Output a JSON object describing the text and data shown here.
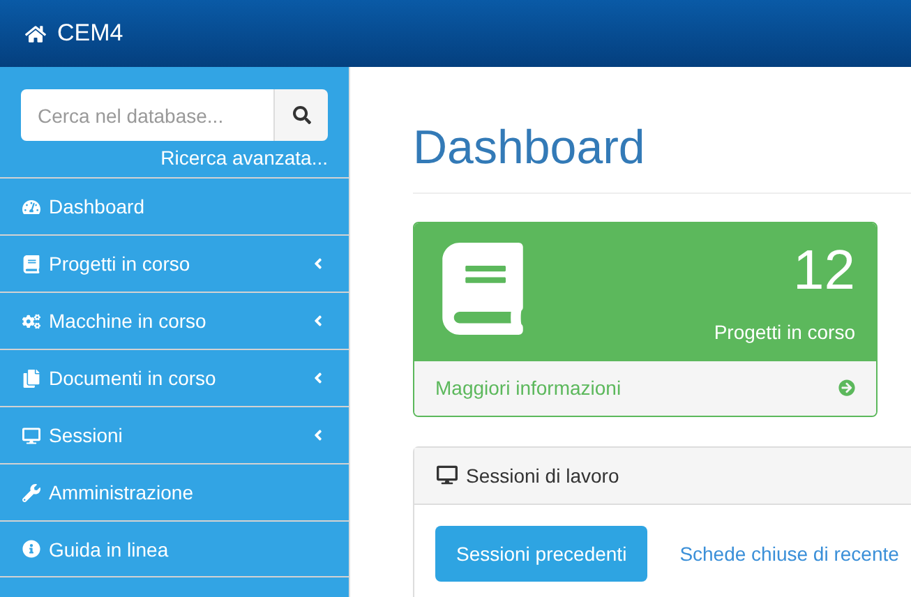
{
  "header": {
    "title": "CEM4"
  },
  "sidebar": {
    "search": {
      "placeholder": "Cerca nel database..."
    },
    "advanced_link": "Ricerca avanzata...",
    "items": [
      {
        "label": "Dashboard",
        "expandable": false
      },
      {
        "label": "Progetti in corso",
        "expandable": true
      },
      {
        "label": "Macchine in corso",
        "expandable": true
      },
      {
        "label": "Documenti in corso",
        "expandable": true
      },
      {
        "label": "Sessioni",
        "expandable": true
      },
      {
        "label": "Amministrazione",
        "expandable": false
      },
      {
        "label": "Guida in linea",
        "expandable": false
      }
    ]
  },
  "page_title": "Dashboard",
  "stat_card": {
    "value": "12",
    "label": "Progetti in corso",
    "link": "Maggiori informazioni"
  },
  "panel": {
    "title": "Sessioni di lavoro",
    "buttons": [
      {
        "label": "Sessioni precedenti",
        "kind": "primary"
      },
      {
        "label": "Schede chiuse di recente",
        "kind": "link"
      }
    ]
  }
}
